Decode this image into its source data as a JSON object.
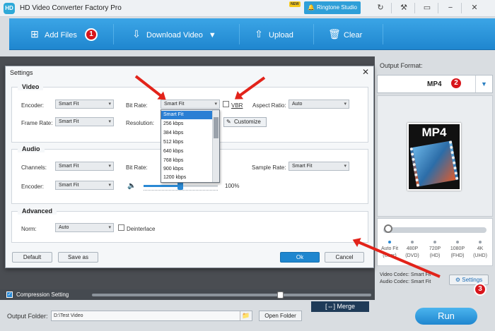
{
  "app": {
    "logo_text": "HD",
    "title": "HD Video Converter Factory Pro",
    "new_badge": "NEW",
    "ringtone_label": "Ringtone Studio"
  },
  "toolbar": {
    "add_files": "Add Files",
    "download_video": "Download Video",
    "upload": "Upload",
    "clear": "Clear"
  },
  "annotations": {
    "badge1": "1",
    "badge2": "2",
    "badge3": "3"
  },
  "output": {
    "label": "Output Format:",
    "format": "MP4",
    "preview_label": "MP4",
    "resolutions": [
      {
        "line1": "Auto Fit",
        "line2": "(User)"
      },
      {
        "line1": "480P",
        "line2": "(DVD)"
      },
      {
        "line1": "720P",
        "line2": "(HD)"
      },
      {
        "line1": "1080P",
        "line2": "(FHD)"
      },
      {
        "line1": "4K",
        "line2": "(UHD)"
      }
    ],
    "video_codec": "Video Codec: Smart Fit",
    "audio_codec": "Audio Codec: Smart Fit",
    "settings_label": "Settings"
  },
  "dialog": {
    "title": "Settings",
    "video": {
      "group_title": "Video",
      "encoder_label": "Encoder:",
      "encoder_value": "Smart Fit",
      "bitrate_label": "Bit Rate:",
      "bitrate_value": "Smart Fit",
      "vbr_label": "VBR",
      "aspect_label": "Aspect Ratio:",
      "aspect_value": "Auto",
      "framerate_label": "Frame Rate:",
      "framerate_value": "Smart Fit",
      "resolution_label": "Resolution:",
      "customize_label": "Customize"
    },
    "bitrate_options": [
      "Smart Fit",
      "256 kbps",
      "384 kbps",
      "512 kbps",
      "640 kbps",
      "768 kbps",
      "900 kbps",
      "1200 kbps"
    ],
    "audio": {
      "group_title": "Audio",
      "channels_label": "Channels:",
      "channels_value": "Smart Fit",
      "bitrate_label": "Bit Rate:",
      "samplerate_label": "Sample Rate:",
      "samplerate_value": "Smart Fit",
      "encoder_label": "Encoder:",
      "encoder_value": "Smart Fit",
      "volume_text": "100%"
    },
    "advanced": {
      "group_title": "Advanced",
      "norm_label": "Norm:",
      "norm_value": "Auto",
      "deinterlace_label": "Deinterlace"
    },
    "buttons": {
      "default": "Default",
      "save_as": "Save as",
      "ok": "Ok",
      "cancel": "Cancel"
    }
  },
  "bottom": {
    "compression_label": "Compression Setting",
    "output_folder_label": "Output Folder:",
    "output_folder_value": "D:\\Test Video",
    "open_folder": "Open Folder",
    "merge": "Merge",
    "run": "Run"
  }
}
